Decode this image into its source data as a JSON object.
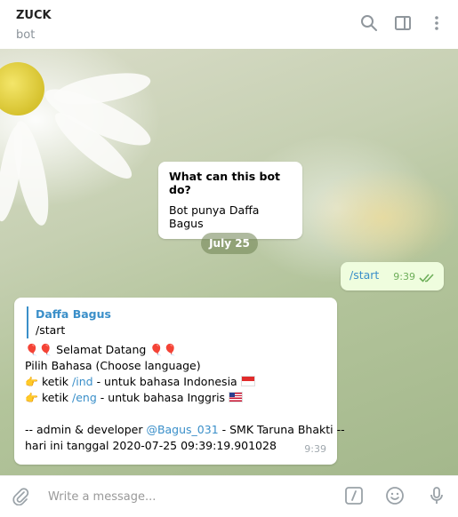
{
  "header": {
    "title": "ZUCK",
    "subtitle": "bot",
    "icons": [
      "search-icon",
      "sidebar-icon",
      "more-icon"
    ]
  },
  "chat": {
    "bot_info": {
      "question": "What can this bot do?",
      "answer": "Bot punya Daffa Bagus"
    },
    "date_divider": "July 25",
    "outgoing": {
      "text": "/start",
      "time": "9:39",
      "status": "read"
    },
    "incoming": {
      "reply_name": "Daffa Bagus",
      "reply_text": "/start",
      "welcome_emoji": "🎈",
      "welcome_text": "Selamat Datang",
      "lang_prompt": "Pilih Bahasa (Choose language)",
      "ind_prefix": "ketik",
      "ind_cmd": "/ind",
      "ind_suffix": "- untuk bahasa Indonesia",
      "eng_prefix": "ketik",
      "eng_cmd": "/eng",
      "eng_suffix": "- untuk bahasa Inggris",
      "footer_prefix": "-- admin & developer",
      "footer_user": "@Bagus_031",
      "footer_suffix": "- SMK Taruna Bhakti --",
      "footer_line2": "hari ini tanggal 2020-07-25 09:39:19.901028",
      "time": "9:39"
    }
  },
  "composer": {
    "placeholder": "Write a message...",
    "icons": [
      "attach-icon",
      "command-icon",
      "emoji-icon",
      "mic-icon"
    ]
  },
  "colors": {
    "link": "#3a8fc9",
    "outgoing_bubble": "#effdde",
    "outgoing_time": "#6dae59"
  }
}
